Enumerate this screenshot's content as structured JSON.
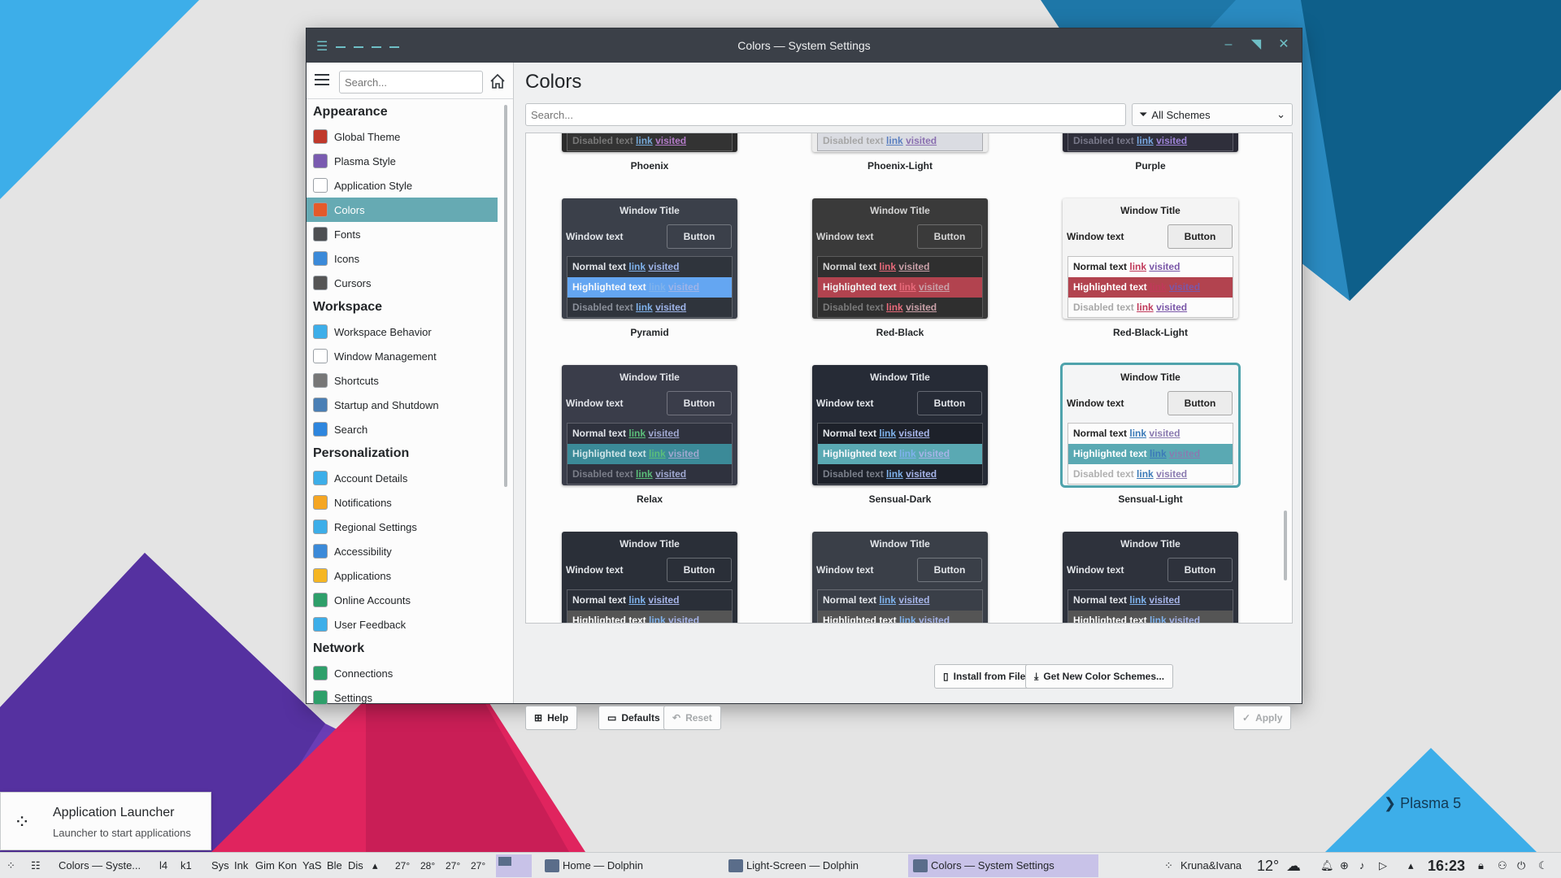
{
  "window": {
    "title": "Colors — System Settings"
  },
  "sidebar": {
    "search_placeholder": "Search...",
    "categories": [
      {
        "label": "Appearance",
        "items": [
          {
            "label": "Global Theme",
            "icon": "global-theme-icon",
            "color": "#c0392b"
          },
          {
            "label": "Plasma Style",
            "icon": "plasma-style-icon",
            "color": "#7a5bb0"
          },
          {
            "label": "Application Style",
            "icon": "application-style-icon",
            "color": "#ffffff"
          },
          {
            "label": "Colors",
            "icon": "colors-icon",
            "color": "#e45a2a",
            "selected": true
          },
          {
            "label": "Fonts",
            "icon": "fonts-icon",
            "color": "#4d4f52"
          },
          {
            "label": "Icons",
            "icon": "icons-icon",
            "color": "#3b8ad9"
          },
          {
            "label": "Cursors",
            "icon": "cursors-icon",
            "color": "#555555"
          }
        ]
      },
      {
        "label": "Workspace",
        "items": [
          {
            "label": "Workspace Behavior",
            "icon": "workspace-behavior-icon",
            "color": "#3daee9"
          },
          {
            "label": "Window Management",
            "icon": "window-management-icon",
            "color": "#ffffff"
          },
          {
            "label": "Shortcuts",
            "icon": "shortcuts-icon",
            "color": "#777777"
          },
          {
            "label": "Startup and Shutdown",
            "icon": "startup-shutdown-icon",
            "color": "#4a7fb5"
          },
          {
            "label": "Search",
            "icon": "search-icon",
            "color": "#2e86de"
          }
        ]
      },
      {
        "label": "Personalization",
        "items": [
          {
            "label": "Account Details",
            "icon": "account-details-icon",
            "color": "#3daee9"
          },
          {
            "label": "Notifications",
            "icon": "notifications-icon",
            "color": "#f5a623"
          },
          {
            "label": "Regional Settings",
            "icon": "regional-settings-icon",
            "color": "#3daee9"
          },
          {
            "label": "Accessibility",
            "icon": "accessibility-icon",
            "color": "#3b8ad9"
          },
          {
            "label": "Applications",
            "icon": "applications-icon",
            "color": "#f5b623"
          },
          {
            "label": "Online Accounts",
            "icon": "online-accounts-icon",
            "color": "#2e9f6a"
          },
          {
            "label": "User Feedback",
            "icon": "user-feedback-icon",
            "color": "#3daee9"
          }
        ]
      },
      {
        "label": "Network",
        "items": [
          {
            "label": "Connections",
            "icon": "connections-icon",
            "color": "#2e9f6a"
          },
          {
            "label": "Settings",
            "icon": "network-settings-icon",
            "color": "#2e9f6a"
          }
        ]
      }
    ]
  },
  "content": {
    "title": "Colors",
    "search_placeholder": "Search...",
    "filter": "All Schemes",
    "preview_labels": {
      "window_title": "Window Title",
      "window_text": "Window text",
      "button": "Button",
      "normal": "Normal text",
      "highlighted": "Highlighted text",
      "disabled": "Disabled text",
      "link": "link",
      "visited": "visited"
    },
    "schemes": [
      {
        "name": "Phoenix",
        "bg": "#2b2b2b",
        "fg": "#d9d9d9",
        "btn": "#2b2b2b",
        "view": "#333333",
        "hl": "#c9a1b0",
        "hlfg": "#3a2a30",
        "link": "#76a9d8",
        "visited": "#b47cc9",
        "dis": "#777777"
      },
      {
        "name": "Phoenix-Light",
        "bg": "#ececec",
        "fg": "#222222",
        "btn": "#f3f3f3",
        "view": "#dadce2",
        "hl": "#b48a9a",
        "hlfg": "#222222",
        "link": "#5a7fc0",
        "visited": "#8a6fb0",
        "dis": "#a6a6a6"
      },
      {
        "name": "Purple",
        "bg": "#2a2a36",
        "fg": "#d9d9e3",
        "btn": "#2a2a36",
        "view": "#2f2f3b",
        "hl": "#8e9cf5",
        "hlfg": "#1a1a2a",
        "link": "#79a9e3",
        "visited": "#9e84d8",
        "dis": "#777788"
      },
      {
        "name": "Pyramid",
        "bg": "#3b404a",
        "fg": "#e3e6ea",
        "btn": "#3b404a",
        "view": "#2f343c",
        "hl": "#64a6f2",
        "hlfg": "#f5f7fa",
        "link": "#7fb2ec",
        "visited": "#9eb4e8",
        "dis": "#8a8f99"
      },
      {
        "name": "Red-Black",
        "bg": "#3a3a3a",
        "fg": "#d6d6d6",
        "btn": "#3a3a3a",
        "view": "#2f2f2f",
        "hl": "#b2434f",
        "hlfg": "#f0f0f0",
        "link": "#e76a7a",
        "visited": "#c9a0a8",
        "dis": "#7a7a7a"
      },
      {
        "name": "Red-Black-Light",
        "bg": "#f4f4f4",
        "fg": "#222222",
        "btn": "#ececec",
        "view": "#fcfcfc",
        "hl": "#b2434f",
        "hlfg": "#ffffff",
        "link": "#c0395a",
        "visited": "#7a57a8",
        "dis": "#a8a8a8"
      },
      {
        "name": "Relax",
        "bg": "#3a3d4a",
        "fg": "#e3e5ea",
        "btn": "#3a3d4a",
        "view": "#2f323e",
        "hl": "#3b8a98",
        "hlfg": "#d0e5e8",
        "link": "#5bbf7a",
        "visited": "#a0a8d0",
        "dis": "#7a7d88"
      },
      {
        "name": "Sensual-Dark",
        "bg": "#262b36",
        "fg": "#e3e6ea",
        "btn": "#262b36",
        "view": "#1d212a",
        "hl": "#5aa9b3",
        "hlfg": "#f5f7fa",
        "link": "#7fb2ec",
        "visited": "#a6b4e8",
        "dis": "#7a7f8a"
      },
      {
        "name": "Sensual-Light",
        "bg": "#f4f5f6",
        "fg": "#222222",
        "btn": "#ececec",
        "view": "#fcfcfc",
        "hl": "#5aa9b3",
        "hlfg": "#ffffff",
        "link": "#3b7ab8",
        "visited": "#8a7ab0",
        "dis": "#b0b0b0",
        "selected": true
      },
      {
        "name": "",
        "bg": "#2a2f38",
        "fg": "#e3e6ea",
        "btn": "#2a2f38",
        "view": "#2a2f38",
        "hl": "#555",
        "hlfg": "#fff",
        "link": "#7fb2ec",
        "visited": "#a6b4e8",
        "dis": "#777"
      },
      {
        "name": "",
        "bg": "#3a3f48",
        "fg": "#e3e6ea",
        "btn": "#3a3f48",
        "view": "#3a3f48",
        "hl": "#555",
        "hlfg": "#fff",
        "link": "#7fb2ec",
        "visited": "#a6b4e8",
        "dis": "#777"
      },
      {
        "name": "",
        "bg": "#2e323c",
        "fg": "#e3e6ea",
        "btn": "#2e323c",
        "view": "#2e323c",
        "hl": "#555",
        "hlfg": "#fff",
        "link": "#7fb2ec",
        "visited": "#a6b4e8",
        "dis": "#777"
      }
    ],
    "buttons": {
      "install": "Install from File...",
      "get_new": "Get New Color Schemes...",
      "help": "Help",
      "defaults": "Defaults",
      "reset": "Reset",
      "apply": "Apply"
    }
  },
  "tooltip": {
    "title": "Application Launcher",
    "subtitle": "Launcher to start applications"
  },
  "desktop": {
    "plasma_label": "Plasma 5"
  },
  "taskbar": {
    "current_window": "Colors — Syste...",
    "pinned": [
      "l4",
      "k1",
      "Sys",
      "Ink",
      "Gim",
      "Kon",
      "YaS",
      "Ble",
      "Dis"
    ],
    "temps": [
      "27°",
      "28°",
      "27°",
      "27°"
    ],
    "tasks": [
      "Home — Dolphin",
      "Light-Screen — Dolphin",
      "Colors — System Settings"
    ],
    "user": "Kruna&Ivana",
    "weather": "12°",
    "clock": "16:23"
  }
}
